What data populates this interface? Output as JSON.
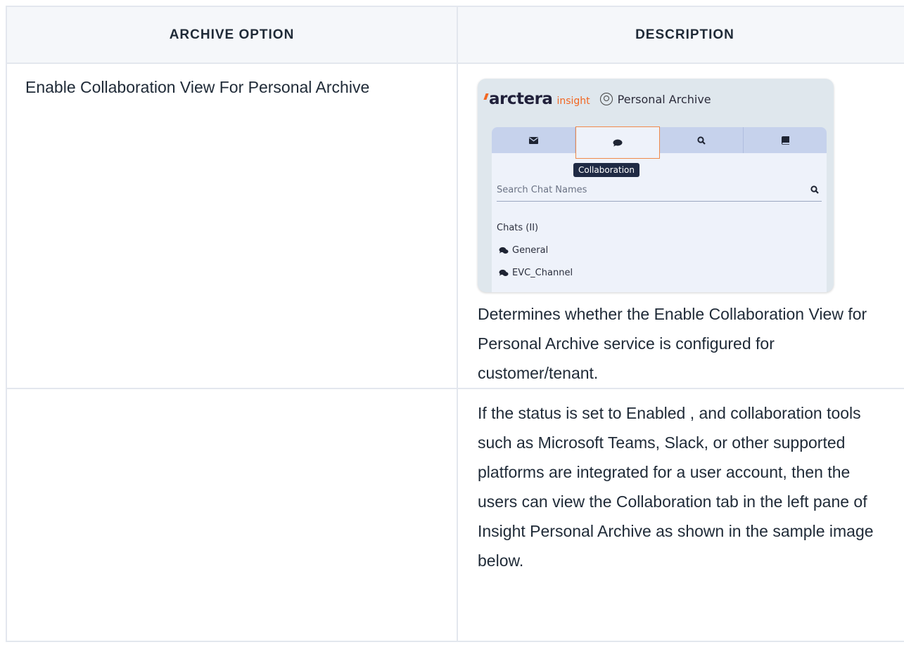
{
  "table": {
    "headers": {
      "archive_option": "ARCHIVE OPTION",
      "description": "DESCRIPTION"
    },
    "rows": [
      {
        "option": "Enable Collaboration View For Personal Archive",
        "description": "Determines whether the Enable Collaboration View for Personal Archive service is configured for customer/tenant."
      },
      {
        "option": "",
        "description": "If the status is set to Enabled , and collaboration tools such as Microsoft Teams, Slack, or other supported platforms are integrated for a user account, then the users can view the Collaboration tab in the left pane of Insight Personal Archive as shown in the sample image below."
      }
    ]
  },
  "sample_image": {
    "brand_name": "arctera",
    "brand_product": "insight",
    "app_title": "Personal Archive",
    "tabs": [
      {
        "icon": "envelope-icon",
        "active": false
      },
      {
        "icon": "chat-bubble-icon",
        "active": true
      },
      {
        "icon": "search-icon",
        "active": false
      },
      {
        "icon": "book-icon",
        "active": false
      }
    ],
    "tooltip": "Collaboration",
    "search_placeholder": "Search Chat Names",
    "chats_title": "Chats (II)",
    "chats": [
      "General",
      "EVC_Channel"
    ],
    "accent_color": "#f26722",
    "tab_bar_color": "#c6d2ec"
  }
}
